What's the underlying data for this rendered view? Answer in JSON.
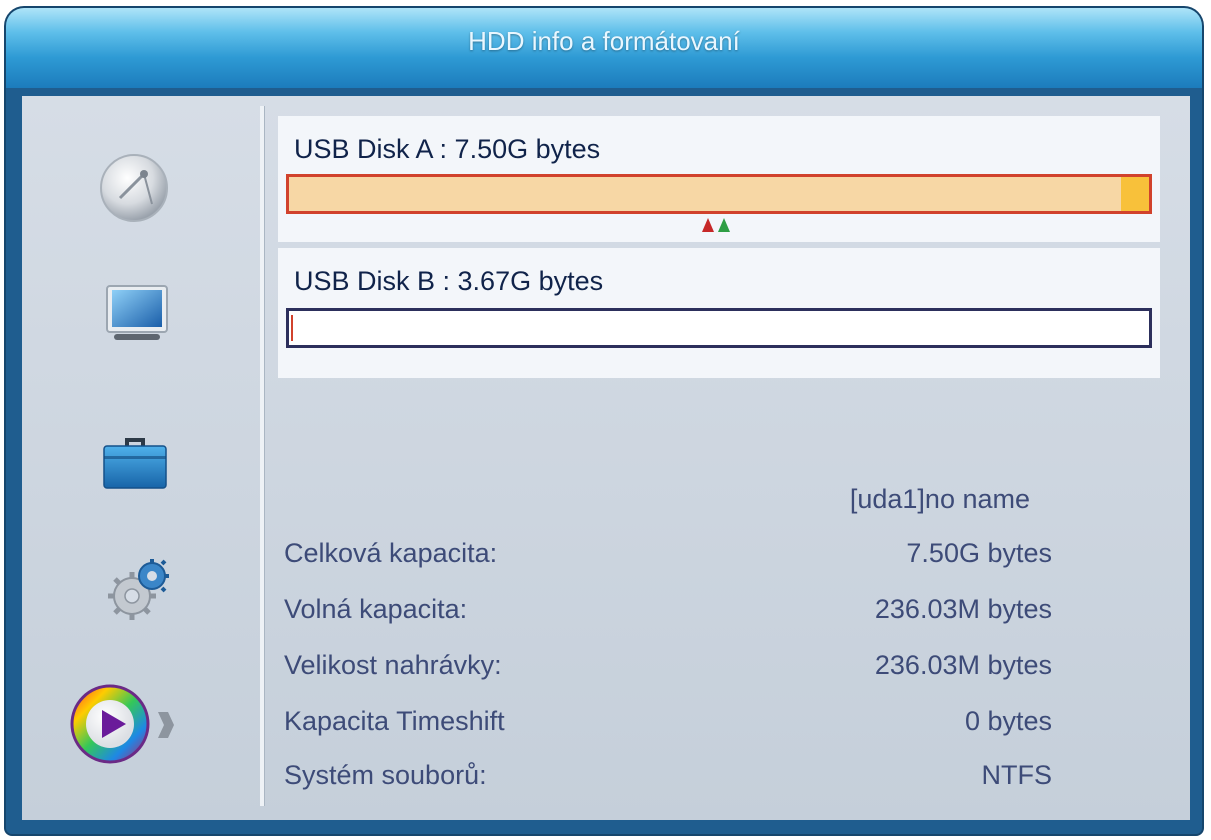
{
  "window": {
    "title": "HDD info a formátovaní"
  },
  "sidebar": {
    "items": [
      {
        "icon": "satellite-dish-icon",
        "selected": false
      },
      {
        "icon": "tv-monitor-icon",
        "selected": false
      },
      {
        "icon": "toolbox-icon",
        "selected": false
      },
      {
        "icon": "gears-icon",
        "selected": false
      },
      {
        "icon": "media-play-icon",
        "selected": true
      }
    ],
    "selected_arrow": "chevron-right-icon"
  },
  "disks": [
    {
      "label": "USB Disk A : 7.50G bytes",
      "used_fraction": 0.97,
      "bar_color": "#f7d7a5",
      "border_color": "#d1422c"
    },
    {
      "label": "USB Disk B : 3.67G bytes",
      "used_fraction": 0.0,
      "bar_color": "#ffffff",
      "border_color": "#2c2f5c"
    }
  ],
  "details": {
    "device_name": "[uda1]no name",
    "rows": [
      {
        "label": "Celková kapacita:",
        "value": "7.50G bytes"
      },
      {
        "label": "Volná kapacita:",
        "value": "236.03M bytes"
      },
      {
        "label": "Velikost nahrávky:",
        "value": "236.03M bytes"
      },
      {
        "label": "Kapacita Timeshift",
        "value": "0 bytes"
      },
      {
        "label": "Systém souborů:",
        "value": "NTFS"
      }
    ]
  },
  "colors": {
    "title_gradient_top": "#aee4f8",
    "title_gradient_bottom": "#1c7cbc",
    "panel_bg": "#d0d8e2",
    "text_primary": "#10234a",
    "text_secondary": "#3d4b78"
  }
}
